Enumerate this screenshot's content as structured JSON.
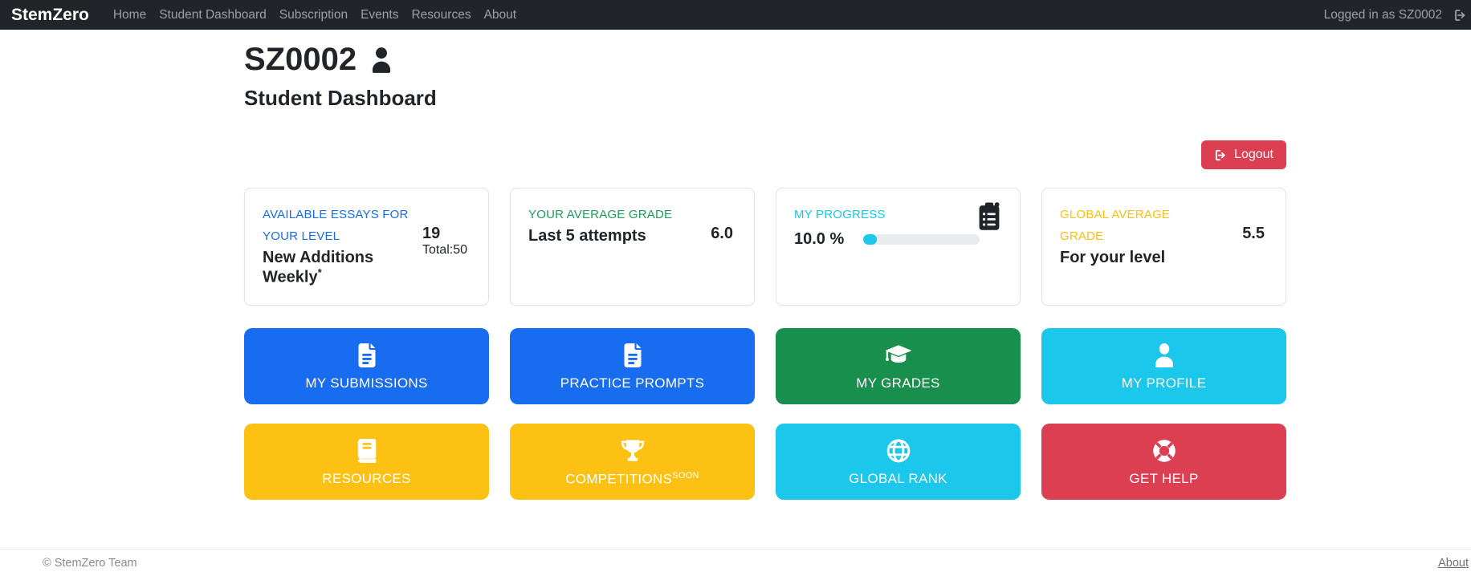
{
  "navbar": {
    "brand": "StemZero",
    "links": [
      "Home",
      "Student Dashboard",
      "Subscription",
      "Events",
      "Resources",
      "About"
    ],
    "logged_in": "Logged in as SZ0002",
    "logout_icon": "logout-icon"
  },
  "header": {
    "student_id": "SZ0002",
    "user_icon": "user-icon",
    "title": "Student Dashboard",
    "logout_label": "Logout",
    "logout_color": "#dc3e52"
  },
  "stats": {
    "available_essays": {
      "title": "AVAILABLE ESSAYS FOR YOUR LEVEL",
      "subtitle": "New Additions Weekly",
      "note": "*",
      "value": "19",
      "total": "Total:50",
      "accent": "#176cf0"
    },
    "average_grade": {
      "title": "YOUR AVERAGE GRADE",
      "subtitle": "Last 5 attempts",
      "value": "6.0",
      "accent": "#1a9e5c"
    },
    "progress": {
      "title": "MY PROGRESS",
      "value": "10.0 %",
      "percent": 10.0,
      "icon": "clipboard-list-icon",
      "accent": "#1bc7ea",
      "track_color": "#e9ecef"
    },
    "global_average": {
      "title": "GLOBAL AVERAGE GRADE",
      "subtitle": "For your level",
      "value": "5.5",
      "accent": "#fcc112"
    }
  },
  "actions": [
    {
      "label": "MY SUBMISSIONS",
      "icon": "document-icon",
      "color": "#176cf0"
    },
    {
      "label": "PRACTICE PROMPTS",
      "icon": "document-icon",
      "color": "#176cf0"
    },
    {
      "label": "MY GRADES",
      "icon": "graduation-cap-icon",
      "color": "#188f4c"
    },
    {
      "label": "MY PROFILE",
      "icon": "user-icon",
      "color": "#1bc7ea"
    },
    {
      "label": "RESOURCES",
      "icon": "book-icon",
      "color": "#fcc112"
    },
    {
      "label": "COMPETITIONS",
      "superscript": "SOON",
      "icon": "trophy-icon",
      "color": "#fcc112"
    },
    {
      "label": "GLOBAL RANK",
      "icon": "globe-icon",
      "color": "#1bc7ea"
    },
    {
      "label": "GET HELP",
      "icon": "life-ring-icon",
      "color": "#dc3e52"
    }
  ],
  "footer": {
    "copyright": "© StemZero Team",
    "about": "About"
  }
}
